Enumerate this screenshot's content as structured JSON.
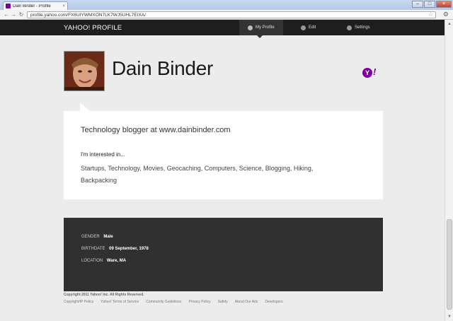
{
  "browser": {
    "tab_title": "Dain Binder - Profile",
    "url": "profile.yahoo.com/FX6UIYWMXON7LK7WJ5UHL7EIXA/"
  },
  "nav": {
    "brand": "YAHOO! PROFILE",
    "items": [
      {
        "label": "My Profile",
        "icon": "person-icon",
        "active": true
      },
      {
        "label": "Edit",
        "icon": "edit-person-icon",
        "active": false
      },
      {
        "label": "Settings",
        "icon": "gear-icon",
        "active": false
      }
    ]
  },
  "profile": {
    "name": "Dain Binder",
    "logo_text": "Y!",
    "about": "Technology blogger at www.dainbinder.com",
    "interests_heading": "I'm interested in...",
    "interests": "Startups, Technology, Movies, Geocaching, Computers, Science, Blogging, Hiking, Backpacking"
  },
  "details": [
    {
      "label": "GENDER",
      "value": "Male"
    },
    {
      "label": "BIRTHDATE",
      "value": "09 September, 1978"
    },
    {
      "label": "LOCATION",
      "value": "Ware, MA"
    }
  ],
  "footer": {
    "copyright": "Copyright 2011 Yahoo! Inc. All Rights Reserved.",
    "links": [
      "Copyright/IP Policy",
      "Yahoo! Terms of Service",
      "Community Guidelines",
      "Privacy Policy",
      "Safety",
      "About Our Ads",
      "Developers"
    ]
  },
  "colors": {
    "nav_bg": "#1e1e1e",
    "yahoo_purple": "#7b0099",
    "detail_bg": "#303030",
    "page_bg": "#ececec"
  }
}
